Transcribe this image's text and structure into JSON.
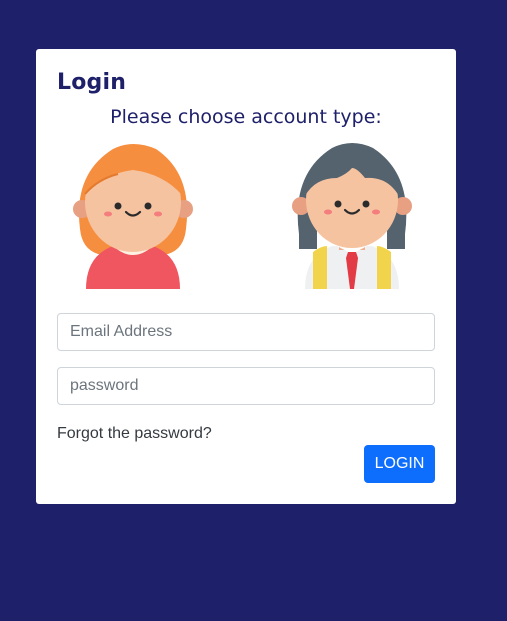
{
  "login_card": {
    "title": "Login",
    "subtitle": "Please choose account type:"
  },
  "account_types": [
    {
      "icon": "girl-avatar-icon"
    },
    {
      "icon": "student-avatar-icon"
    }
  ],
  "form": {
    "email_placeholder": "Email Address",
    "email_value": "",
    "password_placeholder": "password",
    "password_value": "",
    "forgot_label": "Forgot the password?",
    "login_label": "LOGIN"
  },
  "colors": {
    "background": "#1e206a",
    "card": "#ffffff",
    "heading": "#1e206a",
    "primary_button": "#0d6efd"
  }
}
